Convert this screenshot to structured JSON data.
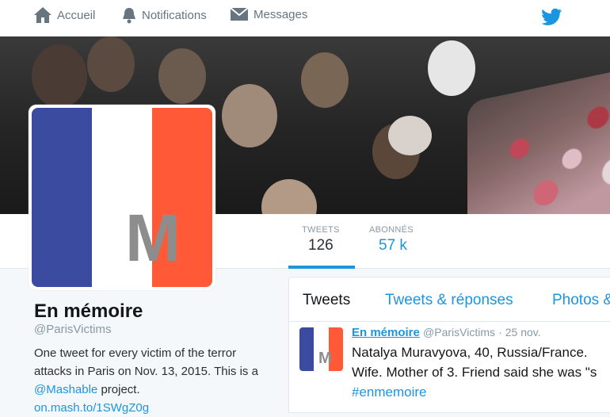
{
  "nav": {
    "home": "Accueil",
    "notifications": "Notifications",
    "messages": "Messages"
  },
  "stats": {
    "tweets_label": "TWEETS",
    "tweets_value": "126",
    "followers_label": "ABONNÉS",
    "followers_value": "57 k"
  },
  "profile": {
    "avatar_letter": "M",
    "name": "En mémoire",
    "handle": "@ParisVictims",
    "bio": "One tweet for every victim of the terror attacks in Paris on Nov. 13, 2015. This is a",
    "bio_mention": "@Mashable",
    "bio_end": "project.",
    "bio_link": "on.mash.to/1SWgZ0g"
  },
  "tabs": [
    "Tweets",
    "Tweets & réponses",
    "Photos &"
  ],
  "tweet": {
    "name": "En mémoire",
    "handle": "@ParisVictims",
    "time": "· 25 nov.",
    "line1": "Natalya Muravyova, 40, Russia/France.",
    "line2": "Wife. Mother of 3. Friend said she was \"s",
    "hashtag": "#enmemoire",
    "avatar_letter": "M"
  },
  "colors": {
    "accent": "#1b95e0",
    "flag_blue": "#3b4ba0",
    "flag_red": "#ff5938"
  }
}
